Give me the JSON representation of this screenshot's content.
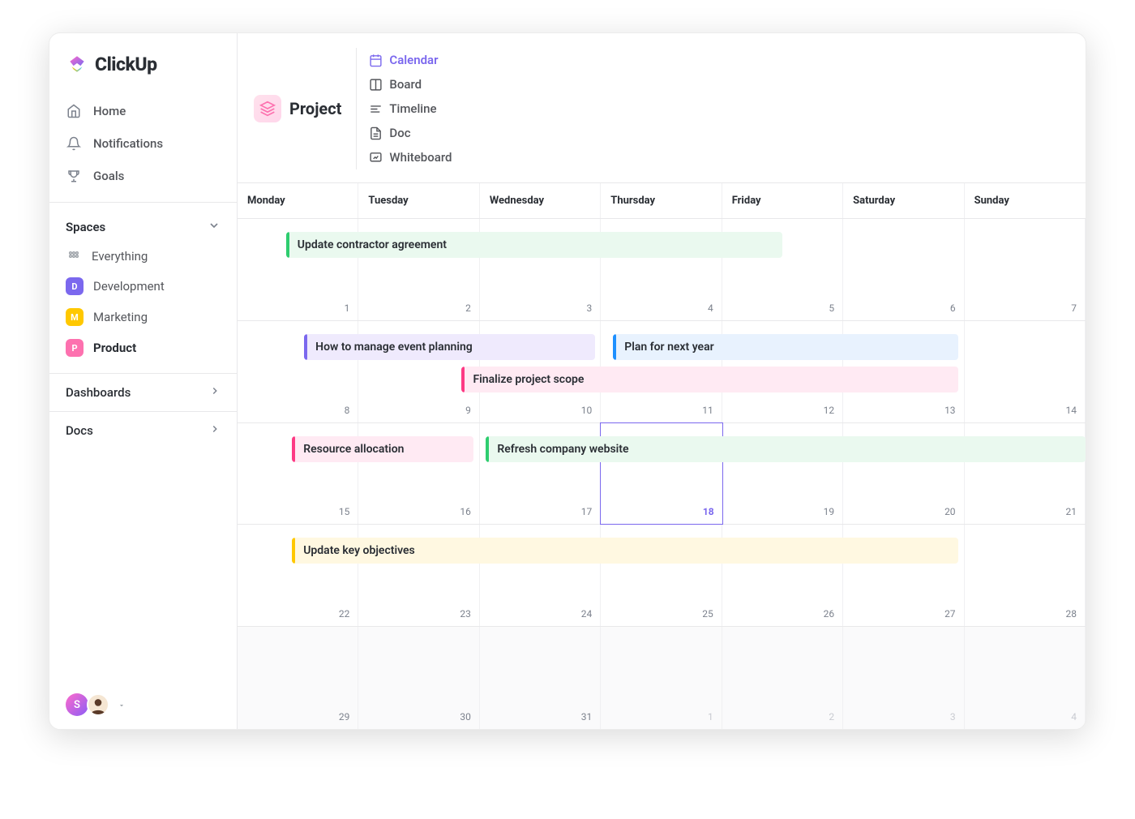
{
  "brand": "ClickUp",
  "sidebar": {
    "nav": [
      {
        "label": "Home",
        "icon": "home"
      },
      {
        "label": "Notifications",
        "icon": "bell"
      },
      {
        "label": "Goals",
        "icon": "trophy"
      }
    ],
    "spaces_header": "Spaces",
    "everything_label": "Everything",
    "spaces": [
      {
        "letter": "D",
        "label": "Development",
        "color": "#7b68ee",
        "bold": false
      },
      {
        "letter": "M",
        "label": "Marketing",
        "color": "#ffc800",
        "bold": false
      },
      {
        "letter": "P",
        "label": "Product",
        "color": "#fd71af",
        "bold": true
      }
    ],
    "sections": [
      {
        "label": "Dashboards"
      },
      {
        "label": "Docs"
      }
    ],
    "avatars": [
      {
        "initial": "S"
      },
      {
        "initial": ""
      }
    ]
  },
  "toolbar": {
    "title": "Project",
    "tabs": [
      {
        "label": "Calendar",
        "icon": "calendar",
        "active": true
      },
      {
        "label": "Board",
        "icon": "board",
        "active": false
      },
      {
        "label": "Timeline",
        "icon": "timeline",
        "active": false
      },
      {
        "label": "Doc",
        "icon": "doc",
        "active": false
      },
      {
        "label": "Whiteboard",
        "icon": "whiteboard",
        "active": false
      }
    ]
  },
  "calendar": {
    "days": [
      "Monday",
      "Tuesday",
      "Wednesday",
      "Thursday",
      "Friday",
      "Saturday",
      "Sunday"
    ],
    "weeks": [
      {
        "nums": [
          "1",
          "2",
          "3",
          "4",
          "5",
          "6",
          "7"
        ],
        "other": [],
        "dim": false
      },
      {
        "nums": [
          "8",
          "9",
          "10",
          "11",
          "12",
          "13",
          "14"
        ],
        "other": [],
        "dim": false
      },
      {
        "nums": [
          "15",
          "16",
          "17",
          "18",
          "19",
          "20",
          "21"
        ],
        "other": [],
        "today_idx": 3,
        "dim": false
      },
      {
        "nums": [
          "22",
          "23",
          "24",
          "25",
          "26",
          "27",
          "28"
        ],
        "other": [],
        "dim": false
      },
      {
        "nums": [
          "29",
          "30",
          "31",
          "1",
          "2",
          "3",
          "4"
        ],
        "other": [
          3,
          4,
          5,
          6
        ],
        "dim": true
      }
    ],
    "events": [
      {
        "week": 0,
        "row": 0,
        "start": 0.4,
        "span": 4.1,
        "label": "Update contractor agreement",
        "bar": "#2ecd6f",
        "bg": "#eaf9ef"
      },
      {
        "week": 1,
        "row": 0,
        "start": 0.55,
        "span": 2.4,
        "label": "How to manage event planning",
        "bar": "#7b68ee",
        "bg": "#efeafd"
      },
      {
        "week": 1,
        "row": 0,
        "start": 3.1,
        "span": 2.85,
        "label": "Plan for next year",
        "bar": "#1e90ff",
        "bg": "#e8f2fe"
      },
      {
        "week": 1,
        "row": 1,
        "start": 1.85,
        "span": 4.1,
        "label": "Finalize project scope",
        "bar": "#fd3a84",
        "bg": "#ffeaf3"
      },
      {
        "week": 2,
        "row": 0,
        "start": 0.45,
        "span": 1.5,
        "label": "Resource allocation",
        "bar": "#fd3a84",
        "bg": "#ffeaf3"
      },
      {
        "week": 2,
        "row": 0,
        "start": 2.05,
        "span": 4.95,
        "label": "Refresh company website",
        "bar": "#2ecd6f",
        "bg": "#eaf9ef"
      },
      {
        "week": 3,
        "row": 0,
        "start": 0.45,
        "span": 5.5,
        "label": "Update key objectives",
        "bar": "#ffc800",
        "bg": "#fff8e1"
      }
    ]
  },
  "colors": {
    "accent": "#7b68ee"
  }
}
